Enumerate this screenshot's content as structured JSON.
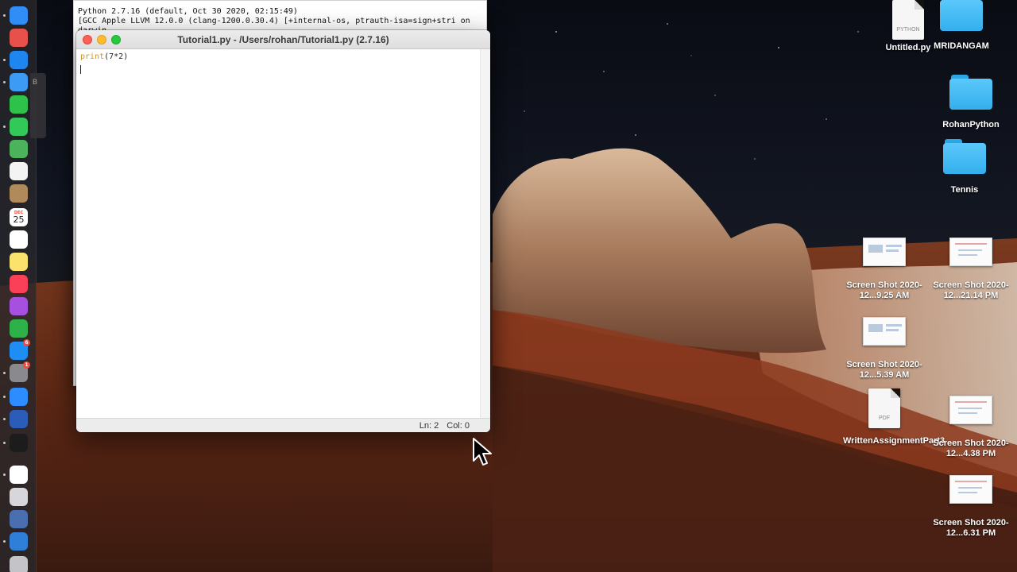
{
  "shell": {
    "lines": [
      "Python 2.7.16 (default, Oct 30 2020, 02:15:49)",
      "[GCC Apple LLVM 12.0.0 (clang-1200.0.30.4) [+internal-os, ptrauth-isa=sign+stri on",
      "darwin"
    ]
  },
  "editor": {
    "title": "Tutorial1.py - /Users/rohan/Tutorial1.py (2.7.16)",
    "code": {
      "builtin": "print",
      "args": "(7*2)"
    },
    "status": {
      "line": "Ln: 2",
      "col": "Col: 0"
    }
  },
  "dock": {
    "peek_label": "B",
    "calendar_day": "25",
    "calendar_month": "DEC",
    "apps": [
      {
        "name": "finder-icon",
        "color": "#2f8df5"
      },
      {
        "name": "launchpad-icon",
        "color": "#e8504b"
      },
      {
        "name": "safari-icon",
        "color": "#1f86f0"
      },
      {
        "name": "mail-icon",
        "color": "#3c9cf5"
      },
      {
        "name": "facetime-icon",
        "color": "#2fc24a"
      },
      {
        "name": "messages-icon",
        "color": "#34c759"
      },
      {
        "name": "maps-icon",
        "color": "#4cb35c"
      },
      {
        "name": "photos-icon",
        "color": "#f3f3f3"
      },
      {
        "name": "contacts-icon",
        "color": "#b08a5a"
      },
      {
        "name": "calendar-icon",
        "color": "#ffffff"
      },
      {
        "name": "reminders-icon",
        "color": "#ffffff"
      },
      {
        "name": "notes-icon",
        "color": "#fbe26c"
      },
      {
        "name": "music-icon",
        "color": "#fa4059"
      },
      {
        "name": "podcasts-icon",
        "color": "#a650e0"
      },
      {
        "name": "numbers-icon",
        "color": "#2fb14a"
      },
      {
        "name": "app-store-icon",
        "color": "#1e8ef5"
      },
      {
        "name": "system-preferences-icon",
        "color": "#8a8a8e"
      },
      {
        "name": "zoom-icon",
        "color": "#2d8cff"
      },
      {
        "name": "word-icon",
        "color": "#2b5cb8"
      },
      {
        "name": "terminal-icon",
        "color": "#1c1c1c"
      },
      {
        "name": "chrome-icon",
        "color": "#ffffff"
      },
      {
        "name": "rocket-icon",
        "color": "#d7d7db"
      },
      {
        "name": "server-icon",
        "color": "#4a6fb0"
      },
      {
        "name": "quicktime-icon",
        "color": "#2f7fd8"
      },
      {
        "name": "trash-icon",
        "color": "#c4c4c8"
      }
    ]
  },
  "desktop": {
    "untitled_kind": "PYTHON",
    "untitled_label": "Untitled.py",
    "mridangam_label": "MRIDANGAM",
    "rohanpython_label": "RohanPython",
    "tennis_label": "Tennis",
    "shot1_label": "Screen Shot 2020-12...9.25 AM",
    "shot2_label": "Screen Shot 2020-12...21.14 PM",
    "shot3_label": "Screen Shot 2020-12...5.39 AM",
    "written_kind": "PDF",
    "written_label": "WrittenAssignmentPart3",
    "shot4_label": "Screen Shot 2020-12...4.38 PM",
    "shot5_label": "Screen Shot 2020-12...6.31 PM"
  },
  "colors": {
    "folder": "#3fb8f5",
    "builtin_keyword": "#d4921b",
    "close_button": "#fe5f57",
    "minimize_button": "#febc2e",
    "zoom_button": "#28c840"
  }
}
